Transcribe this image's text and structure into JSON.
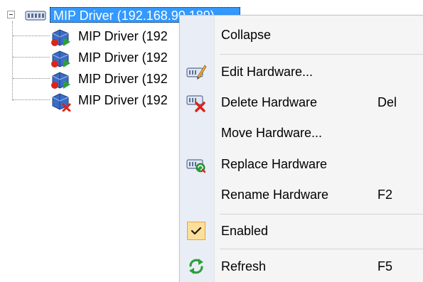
{
  "tree": {
    "root": {
      "label": "MIP Driver (192.168.90.189)",
      "icon": "hardware-icon"
    },
    "children": [
      {
        "label": "MIP Driver (192",
        "icon": "device-warning-icon"
      },
      {
        "label": "MIP Driver (192",
        "icon": "device-warning-icon"
      },
      {
        "label": "MIP Driver (192",
        "icon": "device-warning-icon"
      },
      {
        "label": "MIP Driver (192",
        "icon": "device-disabled-icon"
      }
    ]
  },
  "context_menu": {
    "items": [
      {
        "label": "Collapse",
        "shortcut": "",
        "icon": ""
      },
      {
        "label": "Edit Hardware...",
        "shortcut": "",
        "icon": "edit-hardware-icon"
      },
      {
        "label": "Delete Hardware",
        "shortcut": "Del",
        "icon": "delete-hardware-icon"
      },
      {
        "label": "Move Hardware...",
        "shortcut": "",
        "icon": ""
      },
      {
        "label": "Replace Hardware",
        "shortcut": "",
        "icon": "replace-hardware-icon"
      },
      {
        "label": "Rename Hardware",
        "shortcut": "F2",
        "icon": ""
      },
      {
        "label": "Enabled",
        "shortcut": "",
        "icon": "checkmark-icon",
        "checked": true
      },
      {
        "label": "Refresh",
        "shortcut": "F5",
        "icon": "refresh-icon"
      }
    ]
  },
  "colors": {
    "selection": "#3399ff",
    "menu_background": "#f5f5f5",
    "menu_gutter": "#e9eef6",
    "check_background": "#fddf9a",
    "check_border": "#e7a53a",
    "delete_red": "#d9251b",
    "refresh_green": "#2f9e3a"
  }
}
